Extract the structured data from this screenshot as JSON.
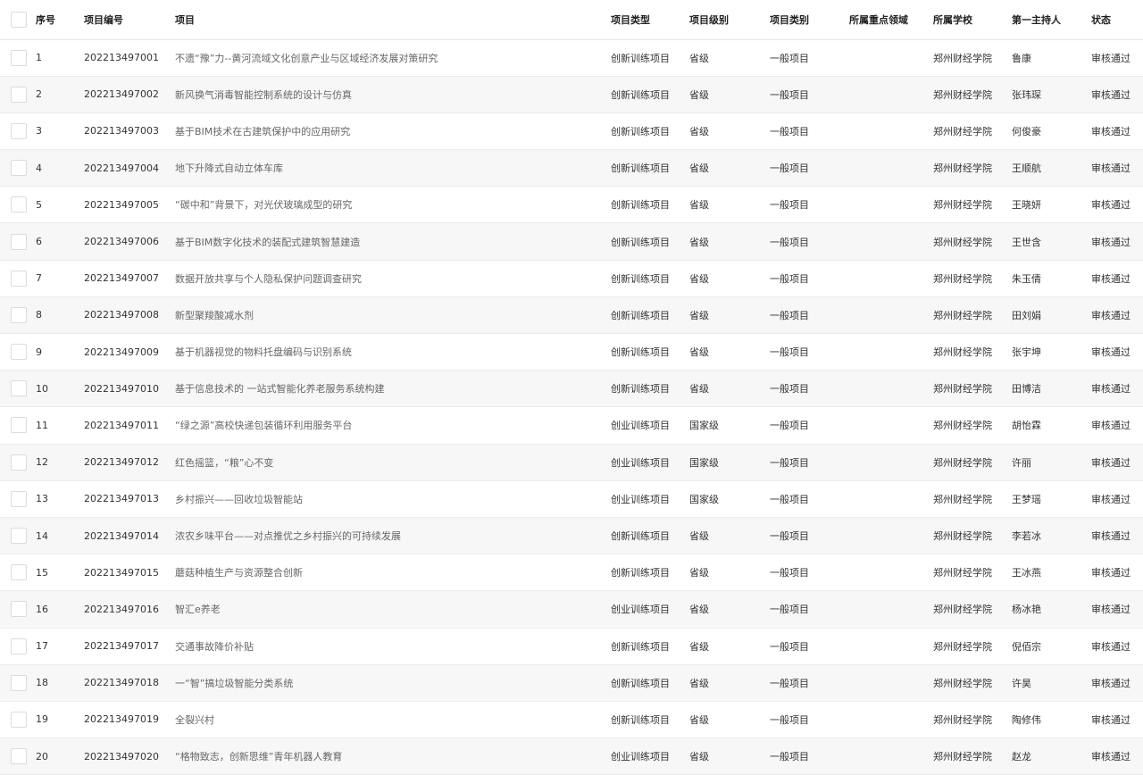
{
  "columns": [
    "序号",
    "项目编号",
    "项目",
    "项目类型",
    "项目级别",
    "项目类别",
    "所属重点领域",
    "所属学校",
    "第一主持人",
    "状态"
  ],
  "rows": [
    {
      "idx": "1",
      "code": "202213497001",
      "name": "不遗“豫”力--黄河流域文化创意产业与区域经济发展对策研究",
      "type": "创新训练项目",
      "level": "省级",
      "category": "一般项目",
      "field": "",
      "school": "郑州财经学院",
      "host": "鲁康",
      "status": "审核通过"
    },
    {
      "idx": "2",
      "code": "202213497002",
      "name": "新风换气消毒智能控制系统的设计与仿真",
      "type": "创新训练项目",
      "level": "省级",
      "category": "一般项目",
      "field": "",
      "school": "郑州财经学院",
      "host": "张玮琛",
      "status": "审核通过"
    },
    {
      "idx": "3",
      "code": "202213497003",
      "name": "基于BIM技术在古建筑保护中的应用研究",
      "type": "创新训练项目",
      "level": "省级",
      "category": "一般项目",
      "field": "",
      "school": "郑州财经学院",
      "host": "何俊豪",
      "status": "审核通过"
    },
    {
      "idx": "4",
      "code": "202213497004",
      "name": "地下升降式自动立体车库",
      "type": "创新训练项目",
      "level": "省级",
      "category": "一般项目",
      "field": "",
      "school": "郑州财经学院",
      "host": "王顺航",
      "status": "审核通过"
    },
    {
      "idx": "5",
      "code": "202213497005",
      "name": "“碳中和”背景下，对光伏玻璃成型的研究",
      "type": "创新训练项目",
      "level": "省级",
      "category": "一般项目",
      "field": "",
      "school": "郑州财经学院",
      "host": "王晓妍",
      "status": "审核通过"
    },
    {
      "idx": "6",
      "code": "202213497006",
      "name": "基于BIM数字化技术的装配式建筑智慧建造",
      "type": "创新训练项目",
      "level": "省级",
      "category": "一般项目",
      "field": "",
      "school": "郑州财经学院",
      "host": "王世含",
      "status": "审核通过"
    },
    {
      "idx": "7",
      "code": "202213497007",
      "name": "数据开放共享与个人隐私保护问题调查研究",
      "type": "创新训练项目",
      "level": "省级",
      "category": "一般项目",
      "field": "",
      "school": "郑州财经学院",
      "host": "朱玉倩",
      "status": "审核通过"
    },
    {
      "idx": "8",
      "code": "202213497008",
      "name": "新型聚羧酸减水剂",
      "type": "创新训练项目",
      "level": "省级",
      "category": "一般项目",
      "field": "",
      "school": "郑州财经学院",
      "host": "田刘娟",
      "status": "审核通过"
    },
    {
      "idx": "9",
      "code": "202213497009",
      "name": "基于机器视觉的物料托盘编码与识别系统",
      "type": "创新训练项目",
      "level": "省级",
      "category": "一般项目",
      "field": "",
      "school": "郑州财经学院",
      "host": "张宇坤",
      "status": "审核通过"
    },
    {
      "idx": "10",
      "code": "202213497010",
      "name": "基于信息技术的 一站式智能化养老服务系统构建",
      "type": "创新训练项目",
      "level": "省级",
      "category": "一般项目",
      "field": "",
      "school": "郑州财经学院",
      "host": "田博洁",
      "status": "审核通过"
    },
    {
      "idx": "11",
      "code": "202213497011",
      "name": "“绿之源”高校快递包装循环利用服务平台",
      "type": "创业训练项目",
      "level": "国家级",
      "category": "一般项目",
      "field": "",
      "school": "郑州财经学院",
      "host": "胡怡霖",
      "status": "审核通过"
    },
    {
      "idx": "12",
      "code": "202213497012",
      "name": "红色摇篮，“粮”心不变",
      "type": "创业训练项目",
      "level": "国家级",
      "category": "一般项目",
      "field": "",
      "school": "郑州财经学院",
      "host": "许丽",
      "status": "审核通过"
    },
    {
      "idx": "13",
      "code": "202213497013",
      "name": "乡村振兴——回收垃圾智能站",
      "type": "创业训练项目",
      "level": "国家级",
      "category": "一般项目",
      "field": "",
      "school": "郑州财经学院",
      "host": "王梦瑶",
      "status": "审核通过"
    },
    {
      "idx": "14",
      "code": "202213497014",
      "name": "浓农乡味平台——对点推优之乡村振兴的可持续发展",
      "type": "创新训练项目",
      "level": "省级",
      "category": "一般项目",
      "field": "",
      "school": "郑州财经学院",
      "host": "李若冰",
      "status": "审核通过"
    },
    {
      "idx": "15",
      "code": "202213497015",
      "name": "蘑菇种植生产与资源整合创新",
      "type": "创新训练项目",
      "level": "省级",
      "category": "一般项目",
      "field": "",
      "school": "郑州财经学院",
      "host": "王冰燕",
      "status": "审核通过"
    },
    {
      "idx": "16",
      "code": "202213497016",
      "name": "智汇e养老",
      "type": "创业训练项目",
      "level": "省级",
      "category": "一般项目",
      "field": "",
      "school": "郑州财经学院",
      "host": "杨冰艳",
      "status": "审核通过"
    },
    {
      "idx": "17",
      "code": "202213497017",
      "name": "交通事故降价补贴",
      "type": "创新训练项目",
      "level": "省级",
      "category": "一般项目",
      "field": "",
      "school": "郑州财经学院",
      "host": "倪佰宗",
      "status": "审核通过"
    },
    {
      "idx": "18",
      "code": "202213497018",
      "name": "一“智”搞垃圾智能分类系统",
      "type": "创新训练项目",
      "level": "省级",
      "category": "一般项目",
      "field": "",
      "school": "郑州财经学院",
      "host": "许昊",
      "status": "审核通过"
    },
    {
      "idx": "19",
      "code": "202213497019",
      "name": "全裂兴村",
      "type": "创新训练项目",
      "level": "省级",
      "category": "一般项目",
      "field": "",
      "school": "郑州财经学院",
      "host": "陶修伟",
      "status": "审核通过"
    },
    {
      "idx": "20",
      "code": "202213497020",
      "name": "“格物致志，创新思维”青年机器人教育",
      "type": "创业训练项目",
      "level": "省级",
      "category": "一般项目",
      "field": "",
      "school": "郑州财经学院",
      "host": "赵龙",
      "status": "审核通过"
    }
  ]
}
